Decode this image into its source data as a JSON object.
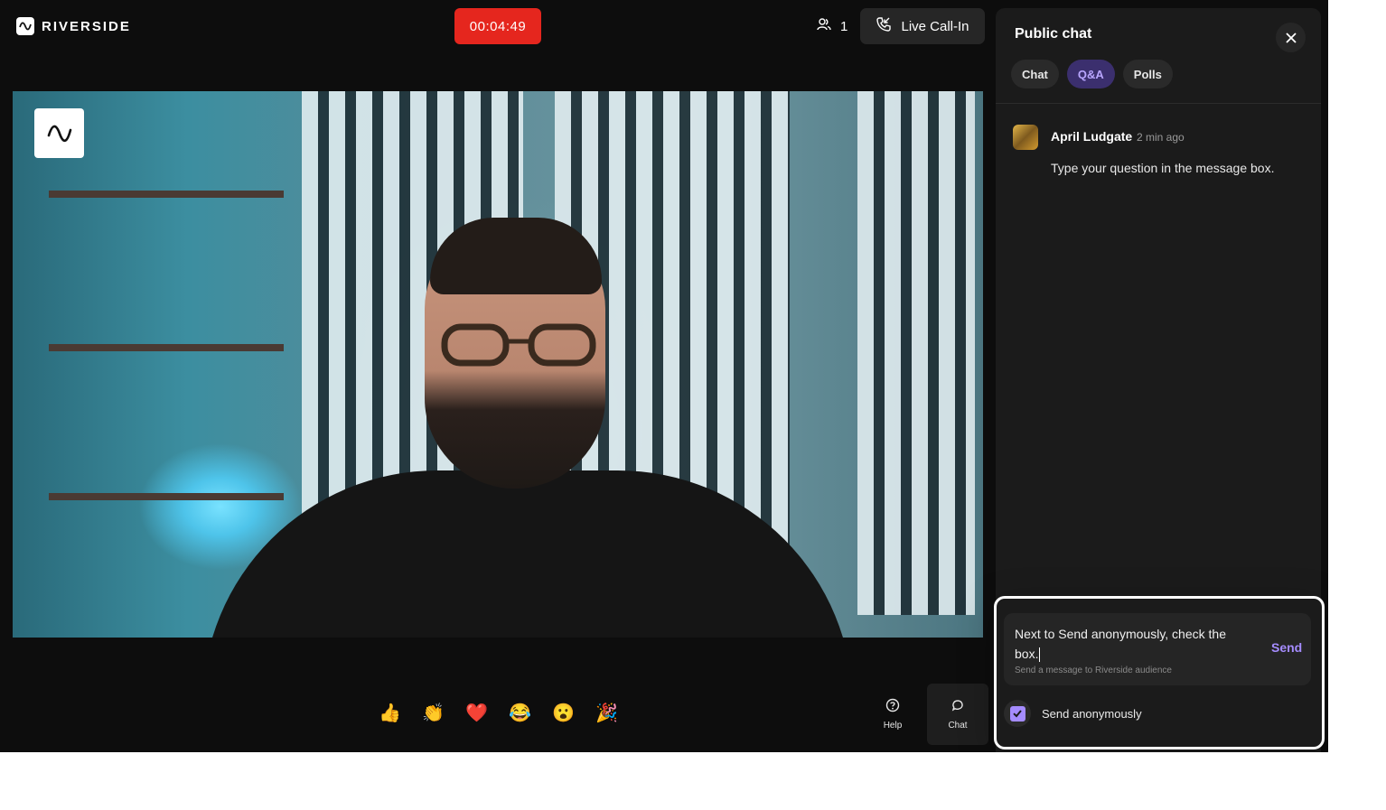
{
  "header": {
    "brand": "RIVERSIDE",
    "timer": "00:04:49",
    "participants_count": "1",
    "callin_label": "Live Call-In"
  },
  "reactions": [
    {
      "name": "thumbs-up",
      "glyph": "👍"
    },
    {
      "name": "clapping-hands",
      "glyph": "👏"
    },
    {
      "name": "red-heart",
      "glyph": "❤️"
    },
    {
      "name": "laughing-face",
      "glyph": "😂"
    },
    {
      "name": "surprised-face",
      "glyph": "😮"
    },
    {
      "name": "party-popper",
      "glyph": "🎉"
    }
  ],
  "toolbar": {
    "help_label": "Help",
    "chat_label": "Chat"
  },
  "side_panel": {
    "title": "Public chat",
    "tabs": [
      {
        "label": "Chat",
        "active": false
      },
      {
        "label": "Q&A",
        "active": true
      },
      {
        "label": "Polls",
        "active": false
      }
    ],
    "messages": [
      {
        "author": "April Ludgate",
        "time": "2 min ago",
        "text": "Type your question in the message box."
      }
    ],
    "composer": {
      "value": "Next to Send anonymously, check the box.",
      "hint": "Send a message to Riverside audience",
      "send_label": "Send"
    },
    "anonymous": {
      "label": "Send anonymously",
      "checked": true
    }
  },
  "colors": {
    "timer_bg": "#e5261e",
    "accent": "#a58cff",
    "active_tab_bg": "#3b2f6e",
    "app_bg": "#0d0d0d",
    "panel_bg": "#1b1b1b"
  }
}
